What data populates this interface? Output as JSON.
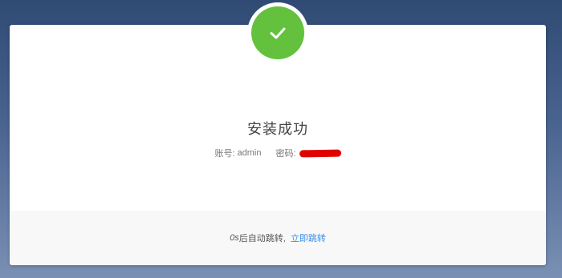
{
  "success": {
    "icon": "check-icon",
    "title": "安装成功",
    "account_label": "账号:",
    "account_value": "admin",
    "password_label": "密码:"
  },
  "redirect": {
    "countdown": "0s",
    "message": " 后自动跳转,",
    "link_label": "立即跳转"
  },
  "colors": {
    "success": "#63c13d",
    "link": "#3a8ee6",
    "redaction": "#e00000"
  }
}
